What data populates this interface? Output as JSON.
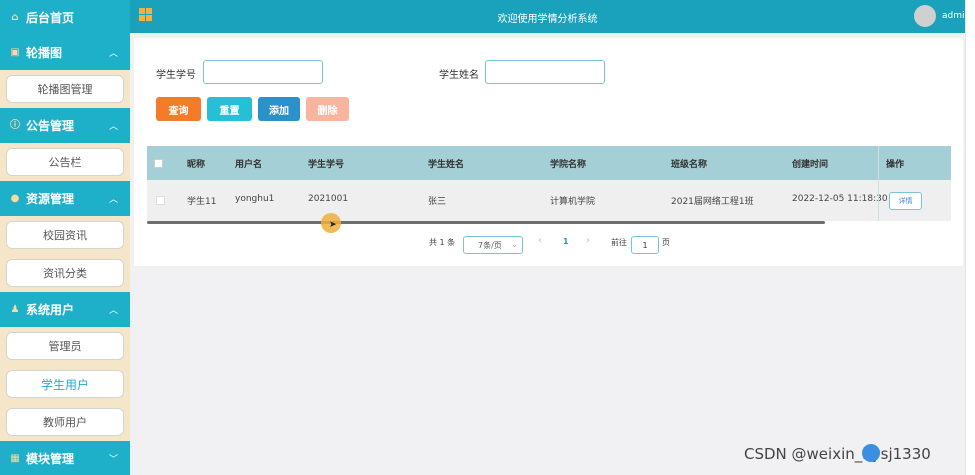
{
  "sidebar": {
    "home": {
      "label": "后台首页",
      "icon": "home-icon"
    },
    "groups": [
      {
        "label": "轮播图",
        "icon": "image-icon",
        "items": [
          "轮播图管理"
        ]
      },
      {
        "label": "公告管理",
        "icon": "info-icon",
        "items": [
          "公告栏"
        ]
      },
      {
        "label": "资源管理",
        "icon": "location-icon",
        "items": [
          "校园资讯",
          "资讯分类"
        ]
      },
      {
        "label": "系统用户",
        "icon": "user-icon",
        "items": [
          "管理员",
          "学生用户",
          "教师用户"
        ]
      },
      {
        "label": "模块管理",
        "icon": "grid-icon"
      }
    ],
    "active_item": "学生用户"
  },
  "topbar": {
    "welcome": "欢迎使用学情分析系统",
    "user": "admin"
  },
  "search": {
    "student_no_label": "学生学号",
    "student_no_value": "",
    "student_name_label": "学生姓名",
    "student_name_value": ""
  },
  "buttons": {
    "query": "查询",
    "reset": "重置",
    "add": "添加",
    "delete": "删除"
  },
  "colors": {
    "query": "#f37b29",
    "reset": "#25bfd6",
    "add": "#2d91c9",
    "delete": "#f8b59e",
    "accent": "#1aa2bc"
  },
  "table": {
    "headers": [
      "昵称",
      "用户名",
      "学生学号",
      "学生姓名",
      "学院名称",
      "班级名称",
      "创建时间",
      "操作"
    ],
    "rows": [
      {
        "nickname": "学生11",
        "username": "yonghu1",
        "student_no": "2021001",
        "student_name": "张三",
        "college": "计算机学院",
        "class_name": "2021届网络工程1班",
        "created": "2022-12-05 11:18:30",
        "action": "详情"
      }
    ]
  },
  "pagination": {
    "total": "共 1 条",
    "page_size": "7条/页",
    "prev": "‹",
    "current": "1",
    "next": "›",
    "goto_label": "前往",
    "goto_value": "1",
    "page_unit": "页"
  },
  "watermark": "CSDN @weixin_bysj1330"
}
